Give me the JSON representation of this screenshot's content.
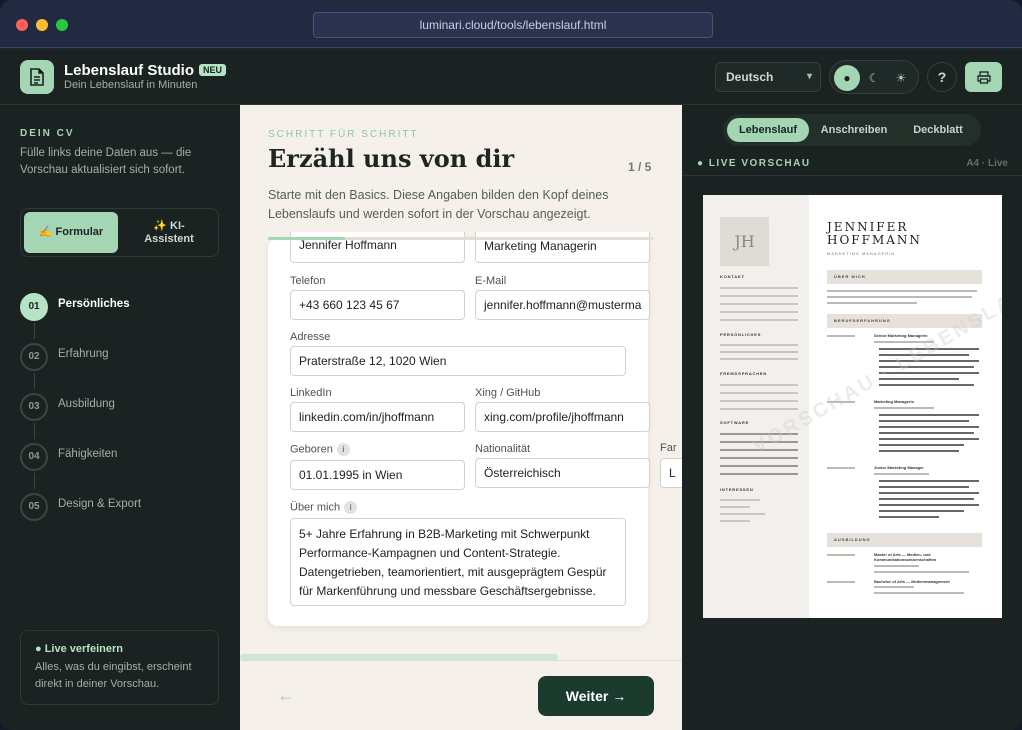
{
  "window": {
    "url": "luminari.cloud/tools/lebenslauf.html"
  },
  "app": {
    "name": "Lebenslauf Studio",
    "badge": "NEU",
    "tagline": "Dein Lebenslauf in Minuten"
  },
  "header": {
    "language": "Deutsch",
    "help": "?"
  },
  "sidebar": {
    "title": "DEIN CV",
    "subtitle": "Fülle links deine Daten aus — die Vorschau aktualisiert sich sofort.",
    "modes": {
      "form": "✍️ Formular",
      "ai": "✨ KI-Assistent"
    },
    "steps": [
      {
        "num": "01",
        "label": "Persönliches",
        "active": true
      },
      {
        "num": "02",
        "label": "Erfahrung",
        "active": false
      },
      {
        "num": "03",
        "label": "Ausbildung",
        "active": false
      },
      {
        "num": "04",
        "label": "Fähigkeiten",
        "active": false
      },
      {
        "num": "05",
        "label": "Design & Export",
        "active": false
      }
    ],
    "tip": {
      "title": "● Live verfeinern",
      "text": "Alles, was du eingibst, erscheint direkt in deiner Vorschau."
    }
  },
  "form": {
    "kicker": "SCHRITT FÜR SCHRITT",
    "title": "Erzähl uns von dir",
    "step_count": "1 / 5",
    "intro": "Starte mit den Basics. Diese Angaben bilden den Kopf deines Lebenslaufs und werden sofort in der Vorschau angezeigt.",
    "progress": 0.2,
    "name_value": "Jennifer Hoffmann",
    "role_value": "Marketing Managerin",
    "phone_label": "Telefon",
    "phone_value": "+43 660 123 45 67",
    "email_label": "E-Mail",
    "email_value": "jennifer.hoffmann@musterma",
    "address_label": "Adresse",
    "address_value": "Praterstraße 12, 1020 Wien",
    "linkedin_label": "LinkedIn",
    "linkedin_value": "linkedin.com/in/jhoffmann",
    "xing_label": "Xing / GitHub",
    "xing_value": "xing.com/profile/jhoffmann",
    "born_label": "Geboren",
    "born_value": "01.01.1995 in Wien",
    "nationality_label": "Nationalität",
    "nationality_value": "Österreichisch",
    "family_label": "Far",
    "family_value": "L",
    "about_label": "Über mich",
    "about_value": "5+ Jahre Erfahrung in B2B-Marketing mit Schwerpunkt Performance-Kampagnen und Content-Strategie. Datengetrieben, teamorientiert, mit ausgeprägtem Gespür für Markenführung und messbare Geschäftsergebnisse.",
    "back": "←",
    "next": "Weiter →"
  },
  "preview": {
    "tabs": [
      "Lebenslauf",
      "Anschreiben",
      "Deckblatt"
    ],
    "live_label": "● LIVE VORSCHAU",
    "format": "A4 · Live",
    "initials": "JH",
    "first": "JENNIFER",
    "last": "HOFFMANN",
    "role": "MARKETING MANAGERIN",
    "side_headings": [
      "KONTAKT",
      "PERSÖNLICHES",
      "FREMDSPRACHEN",
      "SOFTWARE",
      "INTERESSEN"
    ],
    "sections": [
      "ÜBER MICH",
      "BERUFSERFAHRUNG",
      "AUSBILDUNG"
    ],
    "jobs": [
      "Senior Marketing Managerin",
      "Marketing Managerin",
      "Junior Marketing Manager"
    ],
    "schools": [
      "Master of Arts — Medien- und Kommunikationswissenschaften",
      "Bachelor of Arts — Medienmanagement"
    ],
    "watermark": "VORSCHAU · LEBENSLAUF"
  },
  "colors": {
    "accent": "#a4d6b4",
    "dark": "#1a2321",
    "button": "#1c3b2f"
  }
}
